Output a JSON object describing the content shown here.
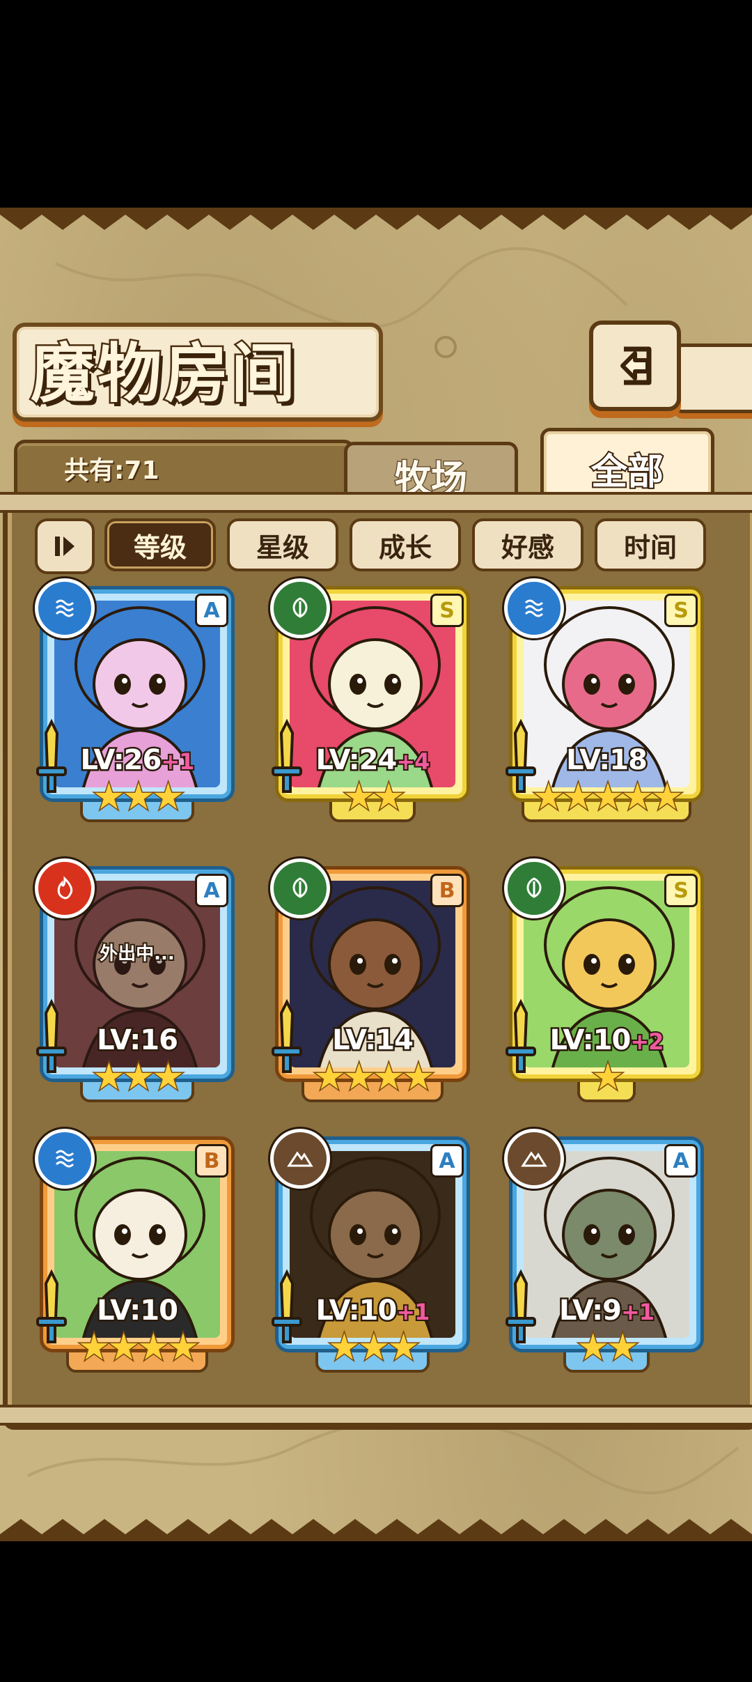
{
  "title": "魔物房间",
  "count_label": "共有:71",
  "tabs": [
    {
      "label": "牧场",
      "active": false
    },
    {
      "label": "全部",
      "active": true
    }
  ],
  "sort": {
    "buttons": [
      {
        "label": "等级",
        "active": true
      },
      {
        "label": "星级",
        "active": false
      },
      {
        "label": "成长",
        "active": false
      },
      {
        "label": "好感",
        "active": false
      },
      {
        "label": "时间",
        "active": false
      }
    ]
  },
  "monsters": [
    {
      "level": "LV:26",
      "bonus": "+1",
      "stars": "★★★",
      "star_count": 3,
      "rank": "A",
      "element": "water-icon",
      "frame": "blue",
      "status": ""
    },
    {
      "level": "LV:24",
      "bonus": "+4",
      "stars": "★★",
      "star_count": 2,
      "rank": "S",
      "element": "leaf-icon",
      "frame": "gold",
      "status": ""
    },
    {
      "level": "LV:18",
      "bonus": "",
      "stars": "★★★★★",
      "star_count": 5,
      "rank": "S",
      "element": "water-icon",
      "frame": "gold",
      "status": ""
    },
    {
      "level": "LV:16",
      "bonus": "",
      "stars": "★★★",
      "star_count": 3,
      "rank": "A",
      "element": "fire-icon",
      "frame": "blue",
      "status": "外出中..."
    },
    {
      "level": "LV:14",
      "bonus": "",
      "stars": "★★★★",
      "star_count": 4,
      "rank": "B",
      "element": "leaf-icon",
      "frame": "orange",
      "status": ""
    },
    {
      "level": "LV:10",
      "bonus": "+2",
      "stars": "★",
      "star_count": 1,
      "rank": "S",
      "element": "leaf-icon",
      "frame": "gold",
      "status": ""
    },
    {
      "level": "LV:10",
      "bonus": "",
      "stars": "★★★★",
      "star_count": 4,
      "rank": "B",
      "element": "water-icon",
      "frame": "orange",
      "status": ""
    },
    {
      "level": "LV:10",
      "bonus": "+1",
      "stars": "★★★",
      "star_count": 3,
      "rank": "A",
      "element": "earth-icon",
      "frame": "blue",
      "status": ""
    },
    {
      "level": "LV:9",
      "bonus": "+1",
      "stars": "★★",
      "star_count": 2,
      "rank": "A",
      "element": "earth-icon",
      "frame": "blue",
      "status": ""
    }
  ],
  "colors": {
    "background": "#c9b582",
    "panel": "#8a6f3f",
    "frame_blue": "#4aa7e0",
    "frame_gold": "#f1d33a",
    "frame_orange": "#f09a3a",
    "star": "#ffd23a",
    "bonus": "#f05aa0"
  }
}
